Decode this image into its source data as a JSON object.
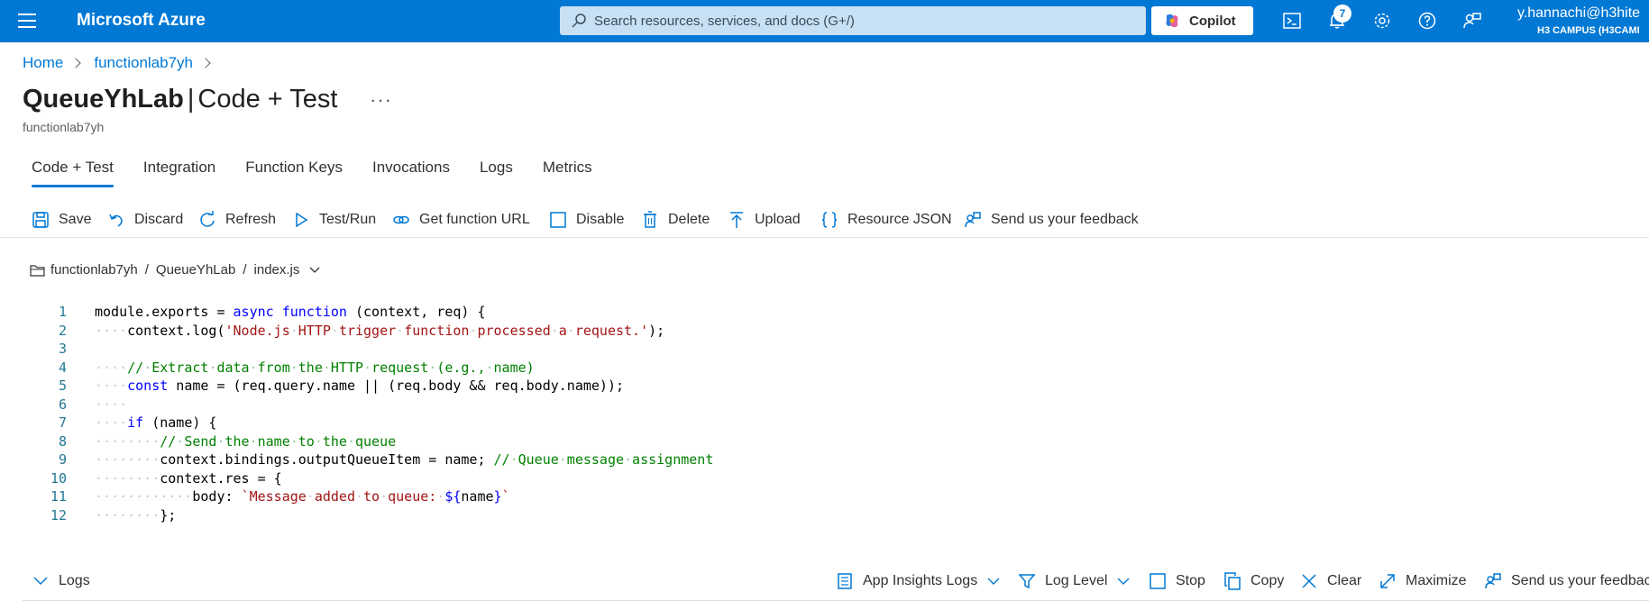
{
  "topbar": {
    "brand": "Microsoft Azure",
    "search_placeholder": "Search resources, services, and docs (G+/)",
    "copilot_label": "Copilot",
    "notification_count": "7",
    "user": "y.hannachi@h3hite",
    "tenant": "H3 CAMPUS (H3CAMI"
  },
  "breadcrumb": {
    "home": "Home",
    "app": "functionlab7yh"
  },
  "header": {
    "title_bold": "QueueYhLab",
    "title_sep": "|",
    "title_rest": "Code + Test",
    "more": "···",
    "subtitle": "functionlab7yh"
  },
  "tabs": [
    "Code + Test",
    "Integration",
    "Function Keys",
    "Invocations",
    "Logs",
    "Metrics"
  ],
  "toolbar": {
    "save": "Save",
    "discard": "Discard",
    "refresh": "Refresh",
    "test_run": "Test/Run",
    "get_url": "Get function URL",
    "disable": "Disable",
    "delete": "Delete",
    "upload": "Upload",
    "resource_json": "Resource JSON",
    "feedback": "Send us your feedback"
  },
  "filepath": {
    "app": "functionlab7yh",
    "function": "QueueYhLab",
    "file": "index.js",
    "sep": "/"
  },
  "editor": {
    "lines": [
      {
        "n": "1",
        "text": "module.exports = async function (context, req) {"
      },
      {
        "n": "2",
        "text": "    context.log('Node.js HTTP trigger function processed a request.');"
      },
      {
        "n": "3",
        "text": ""
      },
      {
        "n": "4",
        "text": "    // Extract data from the HTTP request (e.g., name)"
      },
      {
        "n": "5",
        "text": "    const name = (req.query.name || (req.body && req.body.name));"
      },
      {
        "n": "6",
        "text": "    "
      },
      {
        "n": "7",
        "text": "    if (name) {"
      },
      {
        "n": "8",
        "text": "        // Send the name to the queue"
      },
      {
        "n": "9",
        "text": "        context.bindings.outputQueueItem = name; // Queue message assignment"
      },
      {
        "n": "10",
        "text": "        context.res = {"
      },
      {
        "n": "11",
        "text": "            body: `Message added to queue: ${name}`"
      },
      {
        "n": "12",
        "text": "        };"
      }
    ]
  },
  "logs_bar": {
    "logs": "Logs",
    "app_insights": "App Insights Logs",
    "log_level": "Log Level",
    "stop": "Stop",
    "copy": "Copy",
    "clear": "Clear",
    "maximize": "Maximize",
    "feedback": "Send us your feedbac"
  },
  "colors": {
    "azure_blue": "#0078d4",
    "search_bg": "#c7e0f4",
    "keyword": "#0000ff",
    "comment": "#008000",
    "string": "#a31515",
    "line_number": "#237893"
  }
}
